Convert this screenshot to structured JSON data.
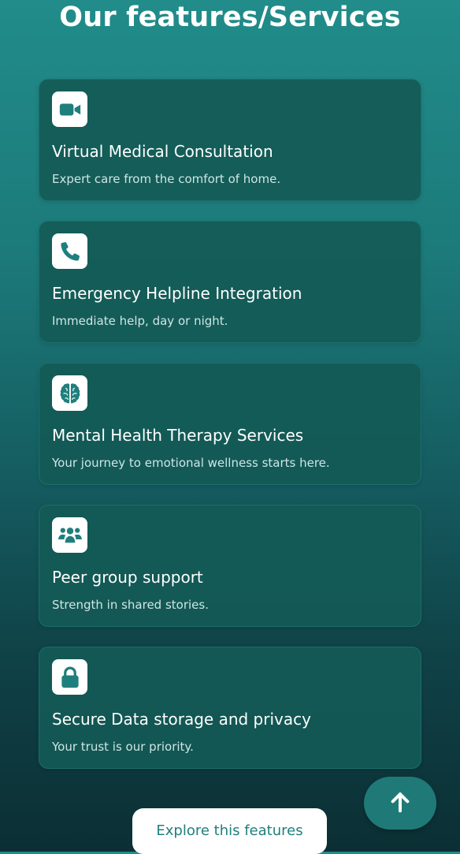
{
  "header": {
    "title": "Our features/Services"
  },
  "features": [
    {
      "icon": "video-camera-icon",
      "title": "Virtual Medical Consultation",
      "description": "Expert care from the comfort of home."
    },
    {
      "icon": "phone-icon",
      "title": "Emergency Helpline Integration",
      "description": "Immediate help, day or night."
    },
    {
      "icon": "brain-icon",
      "title": "Mental Health Therapy Services",
      "description": "Your journey to emotional wellness starts here."
    },
    {
      "icon": "users-group-icon",
      "title": "Peer group support",
      "description": "Strength in shared stories."
    },
    {
      "icon": "lock-icon",
      "title": "Secure Data storage and privacy",
      "description": "Your trust is our priority."
    }
  ],
  "actions": {
    "explore_label": "Explore this features",
    "scroll_top_icon": "arrow-up-icon"
  },
  "colors": {
    "accent": "#1f7f7c",
    "card_background": "#145a56",
    "icon_background": "#ffffff"
  }
}
